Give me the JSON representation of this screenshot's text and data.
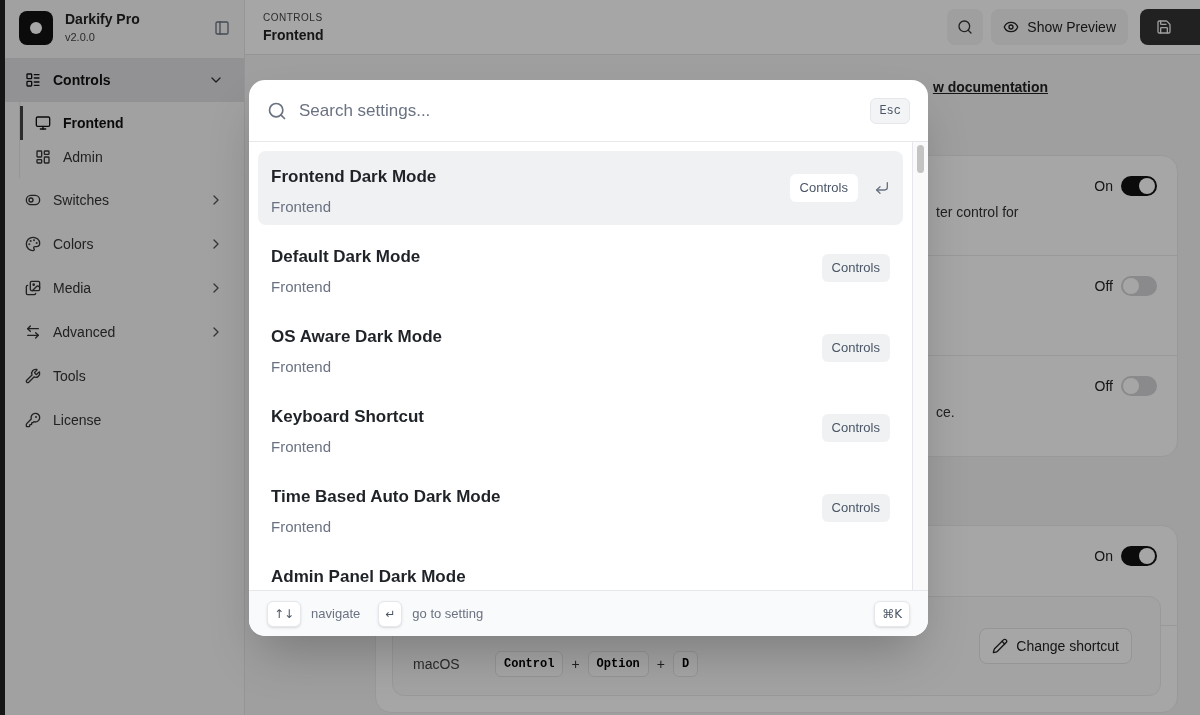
{
  "sidebar": {
    "app_name": "Darkify Pro",
    "version": "v2.0.0",
    "items": [
      {
        "label": "Controls",
        "kind": "group",
        "expanded": true,
        "selected": true,
        "children": [
          {
            "label": "Frontend",
            "selected": true
          },
          {
            "label": "Admin",
            "selected": false
          }
        ]
      },
      {
        "label": "Switches",
        "kind": "group",
        "expanded": false,
        "selected": false
      },
      {
        "label": "Colors",
        "kind": "group",
        "expanded": false,
        "selected": false
      },
      {
        "label": "Media",
        "kind": "group",
        "expanded": false,
        "selected": false
      },
      {
        "label": "Advanced",
        "kind": "group",
        "expanded": false,
        "selected": false
      },
      {
        "label": "Tools",
        "kind": "link",
        "selected": false
      },
      {
        "label": "License",
        "kind": "link",
        "selected": false
      }
    ]
  },
  "header": {
    "section": "CONTROLS",
    "title": "Frontend",
    "preview_button": "Show Preview"
  },
  "doc_link": "w documentation",
  "cards": [
    {
      "rows": [
        {
          "state_label": "On",
          "on": true,
          "description": "ter control for"
        },
        {
          "state_label": "Off",
          "on": false
        },
        {
          "state_label": "Off",
          "on": false,
          "description": "ce."
        }
      ]
    },
    {
      "rows": [
        {
          "state_label": "On",
          "on": true
        }
      ],
      "shortcut": {
        "platform": "macOS",
        "keys": [
          "Control",
          "Option",
          "D"
        ],
        "separator": "+",
        "button": "Change shortcut"
      }
    }
  ],
  "palette": {
    "placeholder": "Search settings...",
    "esc": "Esc",
    "results": [
      {
        "title": "Frontend Dark Mode",
        "section": "Frontend",
        "tag": "Controls",
        "selected": true
      },
      {
        "title": "Default Dark Mode",
        "section": "Frontend",
        "tag": "Controls",
        "selected": false
      },
      {
        "title": "OS Aware Dark Mode",
        "section": "Frontend",
        "tag": "Controls",
        "selected": false
      },
      {
        "title": "Keyboard Shortcut",
        "section": "Frontend",
        "tag": "Controls",
        "selected": false
      },
      {
        "title": "Time Based Auto Dark Mode",
        "section": "Frontend",
        "tag": "Controls",
        "selected": false
      },
      {
        "title": "Admin Panel Dark Mode",
        "selected": false
      }
    ],
    "hints": [
      {
        "key": "↑↓",
        "label": "navigate"
      },
      {
        "key": "↵",
        "label": "go to setting"
      }
    ],
    "shortcut": "⌘K"
  }
}
